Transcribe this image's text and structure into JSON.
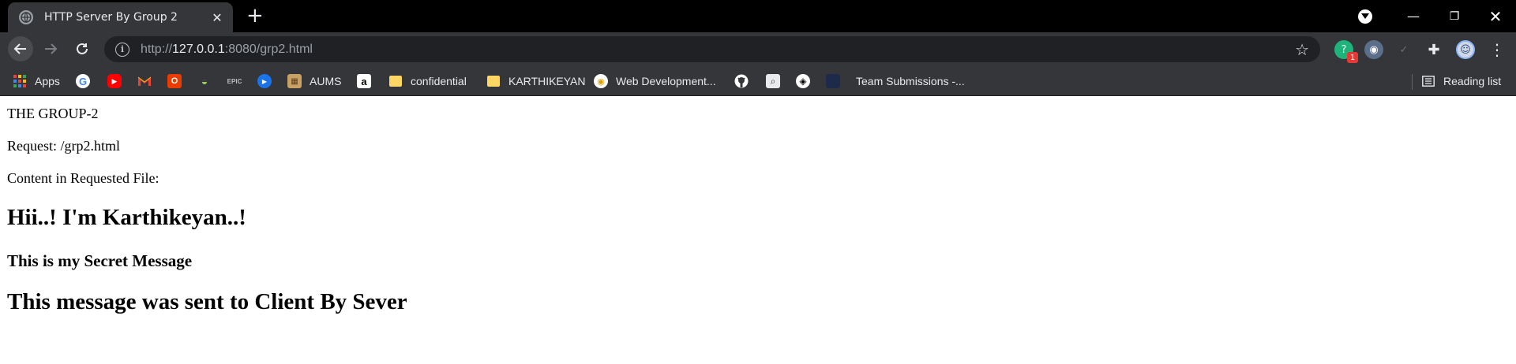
{
  "browser": {
    "tab": {
      "title": "HTTP Server By Group 2",
      "close_label": "✕"
    },
    "new_tab_label": "+",
    "window_controls": {
      "minimize": "—",
      "maximize": "❐",
      "close": "✕"
    },
    "toolbar": {
      "url_prefix": "http://",
      "url_host": "127.0.0.1",
      "url_rest": ":8080/grp2.html"
    },
    "extensions": {
      "badge_count": "1"
    },
    "bookmarks": [
      {
        "label": "Apps",
        "icon": "apps-grid-icon"
      },
      {
        "label": "",
        "icon": "google-icon"
      },
      {
        "label": "",
        "icon": "youtube-icon"
      },
      {
        "label": "",
        "icon": "gmail-icon"
      },
      {
        "label": "",
        "icon": "office-icon"
      },
      {
        "label": "",
        "icon": "extension-icon"
      },
      {
        "label": "",
        "icon": "epic-icon"
      },
      {
        "label": "",
        "icon": "play-icon"
      },
      {
        "label": "AUMS",
        "icon": "aums-icon"
      },
      {
        "label": "",
        "icon": "amazon-icon"
      },
      {
        "label": "confidential",
        "icon": "folder-icon"
      },
      {
        "label": "KARTHIKEYAN",
        "icon": "folder-icon"
      },
      {
        "label": "Web Development...",
        "icon": "webdev-icon"
      },
      {
        "label": "",
        "icon": "github-icon"
      },
      {
        "label": "",
        "icon": "search-icon"
      },
      {
        "label": "",
        "icon": "codepen-icon"
      },
      {
        "label": "Team Submissions -...",
        "icon": "team-icon"
      }
    ],
    "reading_list_label": "Reading list"
  },
  "page": {
    "line1": "THE GROUP-2",
    "line2": "Request: /grp2.html",
    "line3": "Content in Requested File:",
    "heading1": "Hii..! I'm Karthikeyan..!",
    "heading2": "This is my Secret Message",
    "heading3": "This message was sent to Client By Sever"
  },
  "colors": {
    "titlebar": "#000000",
    "toolbar": "#35363a",
    "omnibox": "#202124",
    "page_background": "#ffffff"
  }
}
